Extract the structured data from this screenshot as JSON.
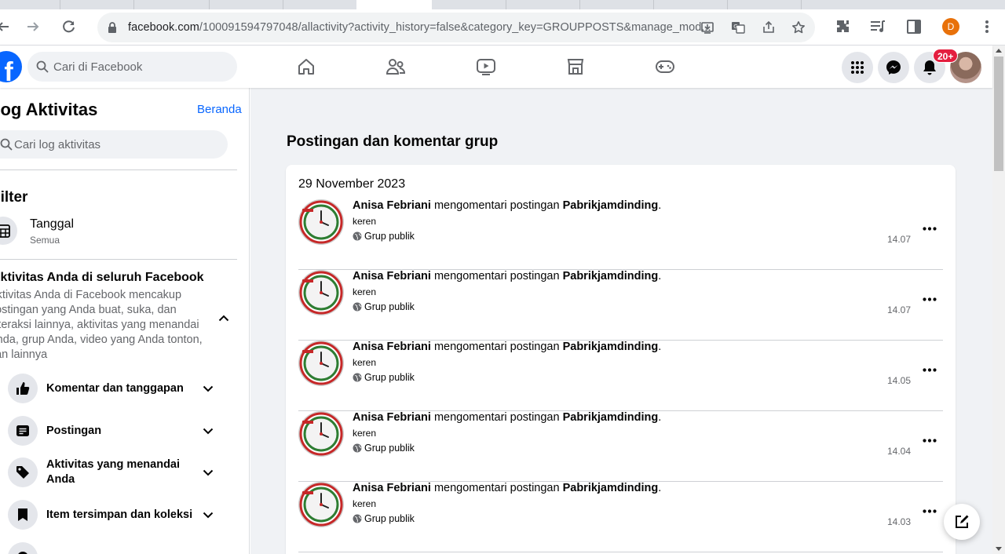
{
  "browser": {
    "url_main": "facebook.com",
    "url_rest": "/100091594797048/allactivity?activity_history=false&category_key=GROUPPOSTS&manage_mod...",
    "profile_initial": "D"
  },
  "fb_header": {
    "logo": "f",
    "search_placeholder": "Cari di Facebook",
    "notification_badge": "20+"
  },
  "sidebar": {
    "title": "Log Aktivitas",
    "home_link": "Beranda",
    "search_placeholder": "Cari log aktivitas",
    "filter_heading": "Filter",
    "date_filter": {
      "label": "Tanggal",
      "value": "Semua"
    },
    "section_heading": "Aktivitas Anda di seluruh Facebook",
    "section_description": "Aktivitas Anda di Facebook mencakup postingan yang Anda buat, suka, dan interaksi lainnya, aktivitas yang menandai Anda, grup Anda, video yang Anda tonton, dan lainnya",
    "items": [
      {
        "label": "Komentar dan tanggapan",
        "icon": "thumbs-up-icon"
      },
      {
        "label": "Postingan",
        "icon": "post-icon"
      },
      {
        "label": "Aktivitas yang menandai Anda",
        "icon": "tag-icon"
      },
      {
        "label": "Item tersimpan dan koleksi",
        "icon": "bookmark-icon"
      }
    ]
  },
  "main": {
    "page_title": "Postingan dan komentar grup",
    "date_header": "29 November 2023",
    "entries": [
      {
        "actor": "Anisa Febriani",
        "action": " mengomentari postingan ",
        "target": "Pabrikjamdinding",
        "comment": "keren",
        "privacy": "Grup publik",
        "time": "14.07"
      },
      {
        "actor": "Anisa Febriani",
        "action": " mengomentari postingan ",
        "target": "Pabrikjamdinding",
        "comment": "keren",
        "privacy": "Grup publik",
        "time": "14.07"
      },
      {
        "actor": "Anisa Febriani",
        "action": " mengomentari postingan ",
        "target": "Pabrikjamdinding",
        "comment": "keren",
        "privacy": "Grup publik",
        "time": "14.05"
      },
      {
        "actor": "Anisa Febriani",
        "action": " mengomentari postingan ",
        "target": "Pabrikjamdinding",
        "comment": "keren",
        "privacy": "Grup publik",
        "time": "14.04"
      },
      {
        "actor": "Anisa Febriani",
        "action": " mengomentari postingan ",
        "target": "Pabrikjamdinding",
        "comment": "keren",
        "privacy": "Grup publik",
        "time": "14.03"
      }
    ]
  },
  "colors": {
    "fb_blue": "#0866ff",
    "badge_red": "#e41e3f",
    "page_bg": "#f0f2f5",
    "profile_orange": "#e8710a"
  }
}
